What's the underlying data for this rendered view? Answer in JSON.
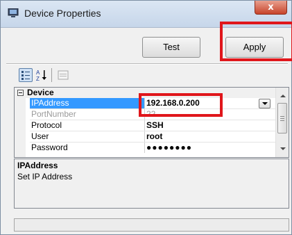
{
  "window": {
    "title": "Device Properties",
    "close_label": "x"
  },
  "toolbar": {
    "test_label": "Test",
    "apply_label": "Apply"
  },
  "grid_toolbar": {
    "alpha_sort_glyph_top": "A",
    "alpha_sort_glyph_bottom": "Z"
  },
  "property_grid": {
    "category": "Device",
    "rows": [
      {
        "name": "IPAddress",
        "value": "192.168.0.200",
        "selected": true
      },
      {
        "name": "PortNumber",
        "value": "22",
        "dimmed": true
      },
      {
        "name": "Protocol",
        "value": "SSH"
      },
      {
        "name": "User",
        "value": "root"
      },
      {
        "name": "Password",
        "value": "●●●●●●●●"
      }
    ]
  },
  "description": {
    "title": "IPAddress",
    "text": "Set IP Address"
  },
  "colors": {
    "selection": "#3399ff",
    "highlight": "#e0161b"
  }
}
